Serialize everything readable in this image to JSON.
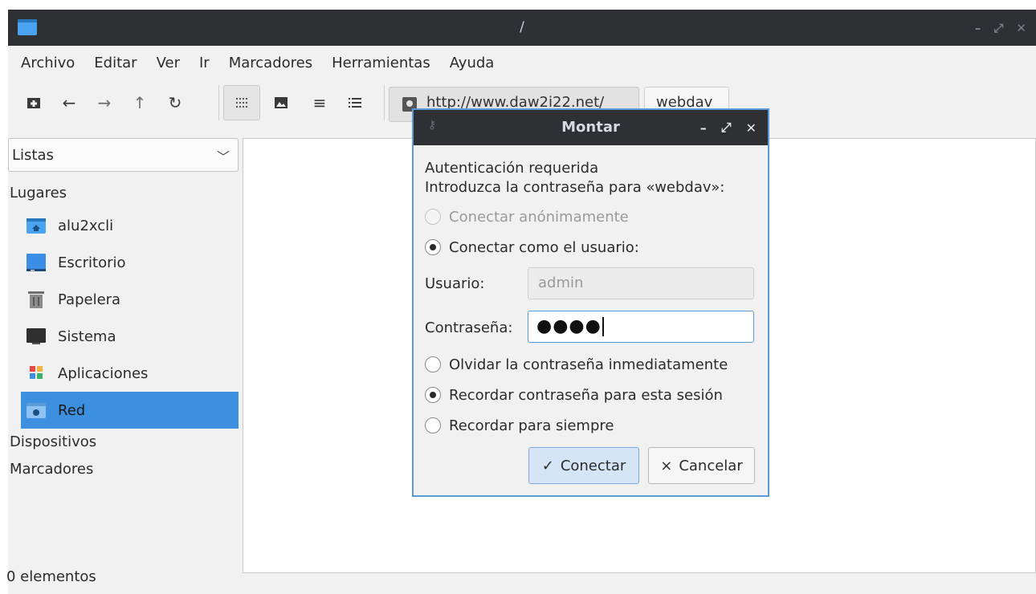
{
  "window": {
    "title": "/",
    "controls": {
      "minimize": "–",
      "maximize": "⤢",
      "close": "✕"
    }
  },
  "menu": [
    "Archivo",
    "Editar",
    "Ver",
    "Ir",
    "Marcadores",
    "Herramientas",
    "Ayuda"
  ],
  "toolbar": {
    "url": "http://www.daw2i22.net/",
    "folder": "webdav"
  },
  "sidebar": {
    "combo_value": "Listas",
    "sections": {
      "places": "Lugares",
      "devices": "Dispositivos",
      "bookmarks": "Marcadores"
    },
    "places": [
      {
        "label": "alu2xcli",
        "icon": "home-folder-icon"
      },
      {
        "label": "Escritorio",
        "icon": "desktop-icon"
      },
      {
        "label": "Papelera",
        "icon": "trash-icon"
      },
      {
        "label": "Sistema",
        "icon": "computer-icon"
      },
      {
        "label": "Aplicaciones",
        "icon": "applications-icon"
      },
      {
        "label": "Red",
        "icon": "network-folder-icon",
        "selected": true
      }
    ]
  },
  "status": "0 elementos",
  "dialog": {
    "title": "Montar",
    "heading": "Autenticación requerida",
    "prompt": "Introduzca la contraseña para «webdav»:",
    "anon_label": "Conectar anónimamente",
    "user_label_radio": "Conectar como el usuario:",
    "user_label": "Usuario:",
    "user_value": "admin",
    "pass_label": "Contraseña:",
    "pass_mask": "●●●●",
    "opt_forget": "Olvidar la contraseña inmediatamente",
    "opt_session": "Recordar contraseña para esta sesión",
    "opt_forever": "Recordar para siempre",
    "ok_label": "Conectar",
    "cancel_label": "Cancelar",
    "ok_glyph": "✓",
    "cancel_glyph": "×",
    "controls": {
      "minimize": "–",
      "maximize": "⤢",
      "close": "✕"
    }
  },
  "colors": {
    "accent": "#3d8fe0",
    "titlebar": "#2e3033",
    "dialog_border": "#5a9ad6"
  }
}
